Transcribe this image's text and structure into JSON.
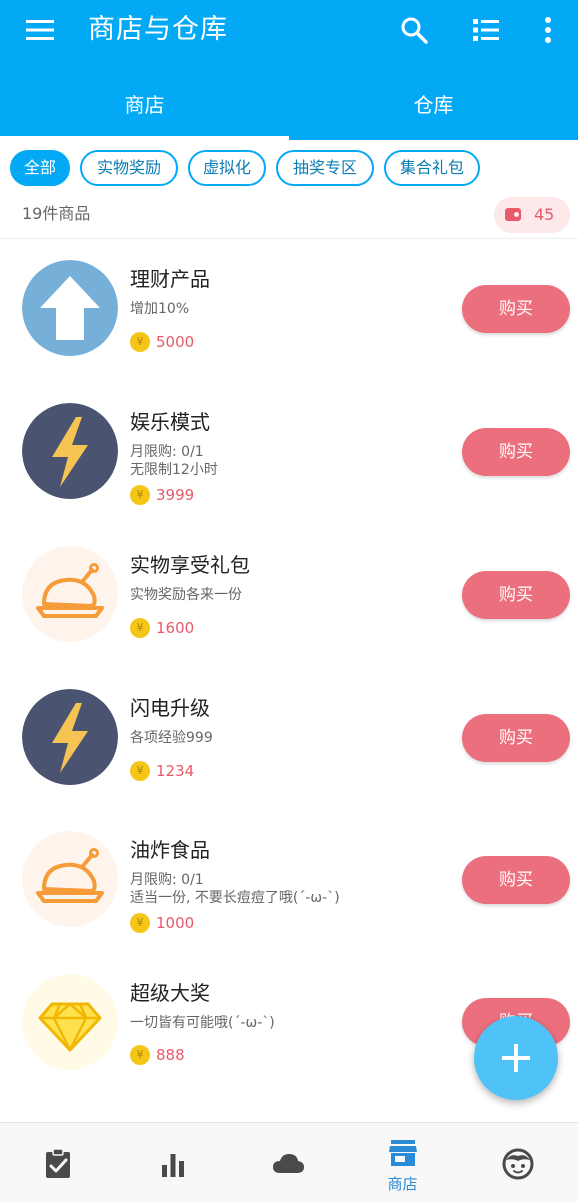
{
  "app": {
    "title": "商店与仓库",
    "icons": [
      "menu-icon",
      "search-icon",
      "list-icon",
      "more-vert-icon"
    ]
  },
  "tabs": [
    {
      "label": "商店",
      "selected": true
    },
    {
      "label": "仓库",
      "selected": false
    }
  ],
  "filters": [
    {
      "label": "全部",
      "active": true
    },
    {
      "label": "实物奖励",
      "active": false
    },
    {
      "label": "虚拟化",
      "active": false
    },
    {
      "label": "抽奖专区",
      "active": false
    },
    {
      "label": "集合礼包",
      "active": false
    }
  ],
  "summary": {
    "count_text": "19件商品",
    "coins": "45",
    "coins_icon": "wallet-icon"
  },
  "items": [
    {
      "name": "理财产品",
      "desc1": "增加10%",
      "desc2": "",
      "price": "5000",
      "icon": "arrow-up-icon",
      "buy_label": "购买"
    },
    {
      "name": "娱乐模式",
      "desc1": "月限购: 0/1",
      "desc2": "无限制12小时",
      "price": "3999",
      "icon": "lightning-icon",
      "buy_label": "购买"
    },
    {
      "name": "实物享受礼包",
      "desc1": "实物奖励各来一份",
      "desc2": "",
      "price": "1600",
      "icon": "roast-chicken-icon",
      "buy_label": "购买"
    },
    {
      "name": "闪电升级",
      "desc1": "各项经验999",
      "desc2": "",
      "price": "1234",
      "icon": "lightning-icon",
      "buy_label": "购买"
    },
    {
      "name": "油炸食品",
      "desc1": "月限购: 0/1",
      "desc2": "适当一份, 不要长痘痘了哦(´-ω-`)",
      "price": "1000",
      "icon": "roast-chicken-icon",
      "buy_label": "购买"
    },
    {
      "name": "超级大奖",
      "desc1": "一切皆有可能哦(´-ω-`)",
      "desc2": "",
      "price": "888",
      "icon": "diamond-icon",
      "buy_label": "购买"
    }
  ],
  "fab": {
    "icon": "plus-icon"
  },
  "bottom_nav": [
    {
      "icon": "clipboard-check-icon",
      "label": "",
      "active": false
    },
    {
      "icon": "bar-chart-icon",
      "label": "",
      "active": false
    },
    {
      "icon": "cloud-icon",
      "label": "",
      "active": false
    },
    {
      "icon": "store-icon",
      "label": "商店",
      "active": true
    },
    {
      "icon": "face-icon",
      "label": "",
      "active": false
    }
  ],
  "colors": {
    "primary": "#03a9f4",
    "accent": "#ec6f7e",
    "price": "#e85a6a",
    "coin": "#f5c518",
    "nav_active": "#2a8bd6"
  }
}
